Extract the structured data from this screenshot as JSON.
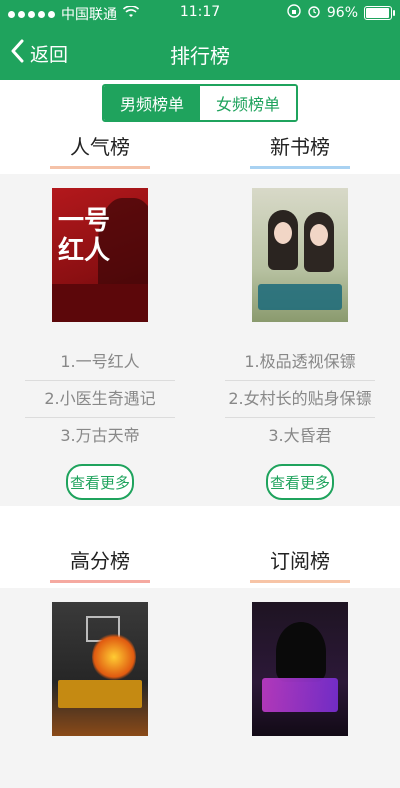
{
  "statusbar": {
    "carrier": "中国联通",
    "time": "11:17",
    "battery": "96%",
    "battery_level": 0.96
  },
  "navbar": {
    "back_label": "返回",
    "title": "排行榜"
  },
  "segment": {
    "male": "男频榜单",
    "female": "女频榜单",
    "selected": "male"
  },
  "sections": [
    {
      "left": {
        "title": "人气榜",
        "underline_color": "#f5c2a8",
        "list": [
          "1.一号红人",
          "2.小医生奇遇记",
          "3.万古天帝"
        ],
        "more": "查看更多"
      },
      "right": {
        "title": "新书榜",
        "underline_color": "#a9d2f2",
        "list": [
          "1.极品透视保镖",
          "2.女村长的贴身保镖",
          "3.大昏君"
        ],
        "more": "查看更多"
      }
    },
    {
      "left": {
        "title": "高分榜",
        "underline_color": "#f5a9a0"
      },
      "right": {
        "title": "订阅榜",
        "underline_color": "#f7c4a6"
      }
    }
  ],
  "colors": {
    "brand": "#1fa35d",
    "muted_text": "#888888"
  },
  "icons": {
    "back": "chevron-left-icon",
    "wifi": "wifi-icon",
    "lock": "rotation-lock-icon",
    "alarm": "alarm-icon",
    "battery": "battery-icon"
  }
}
